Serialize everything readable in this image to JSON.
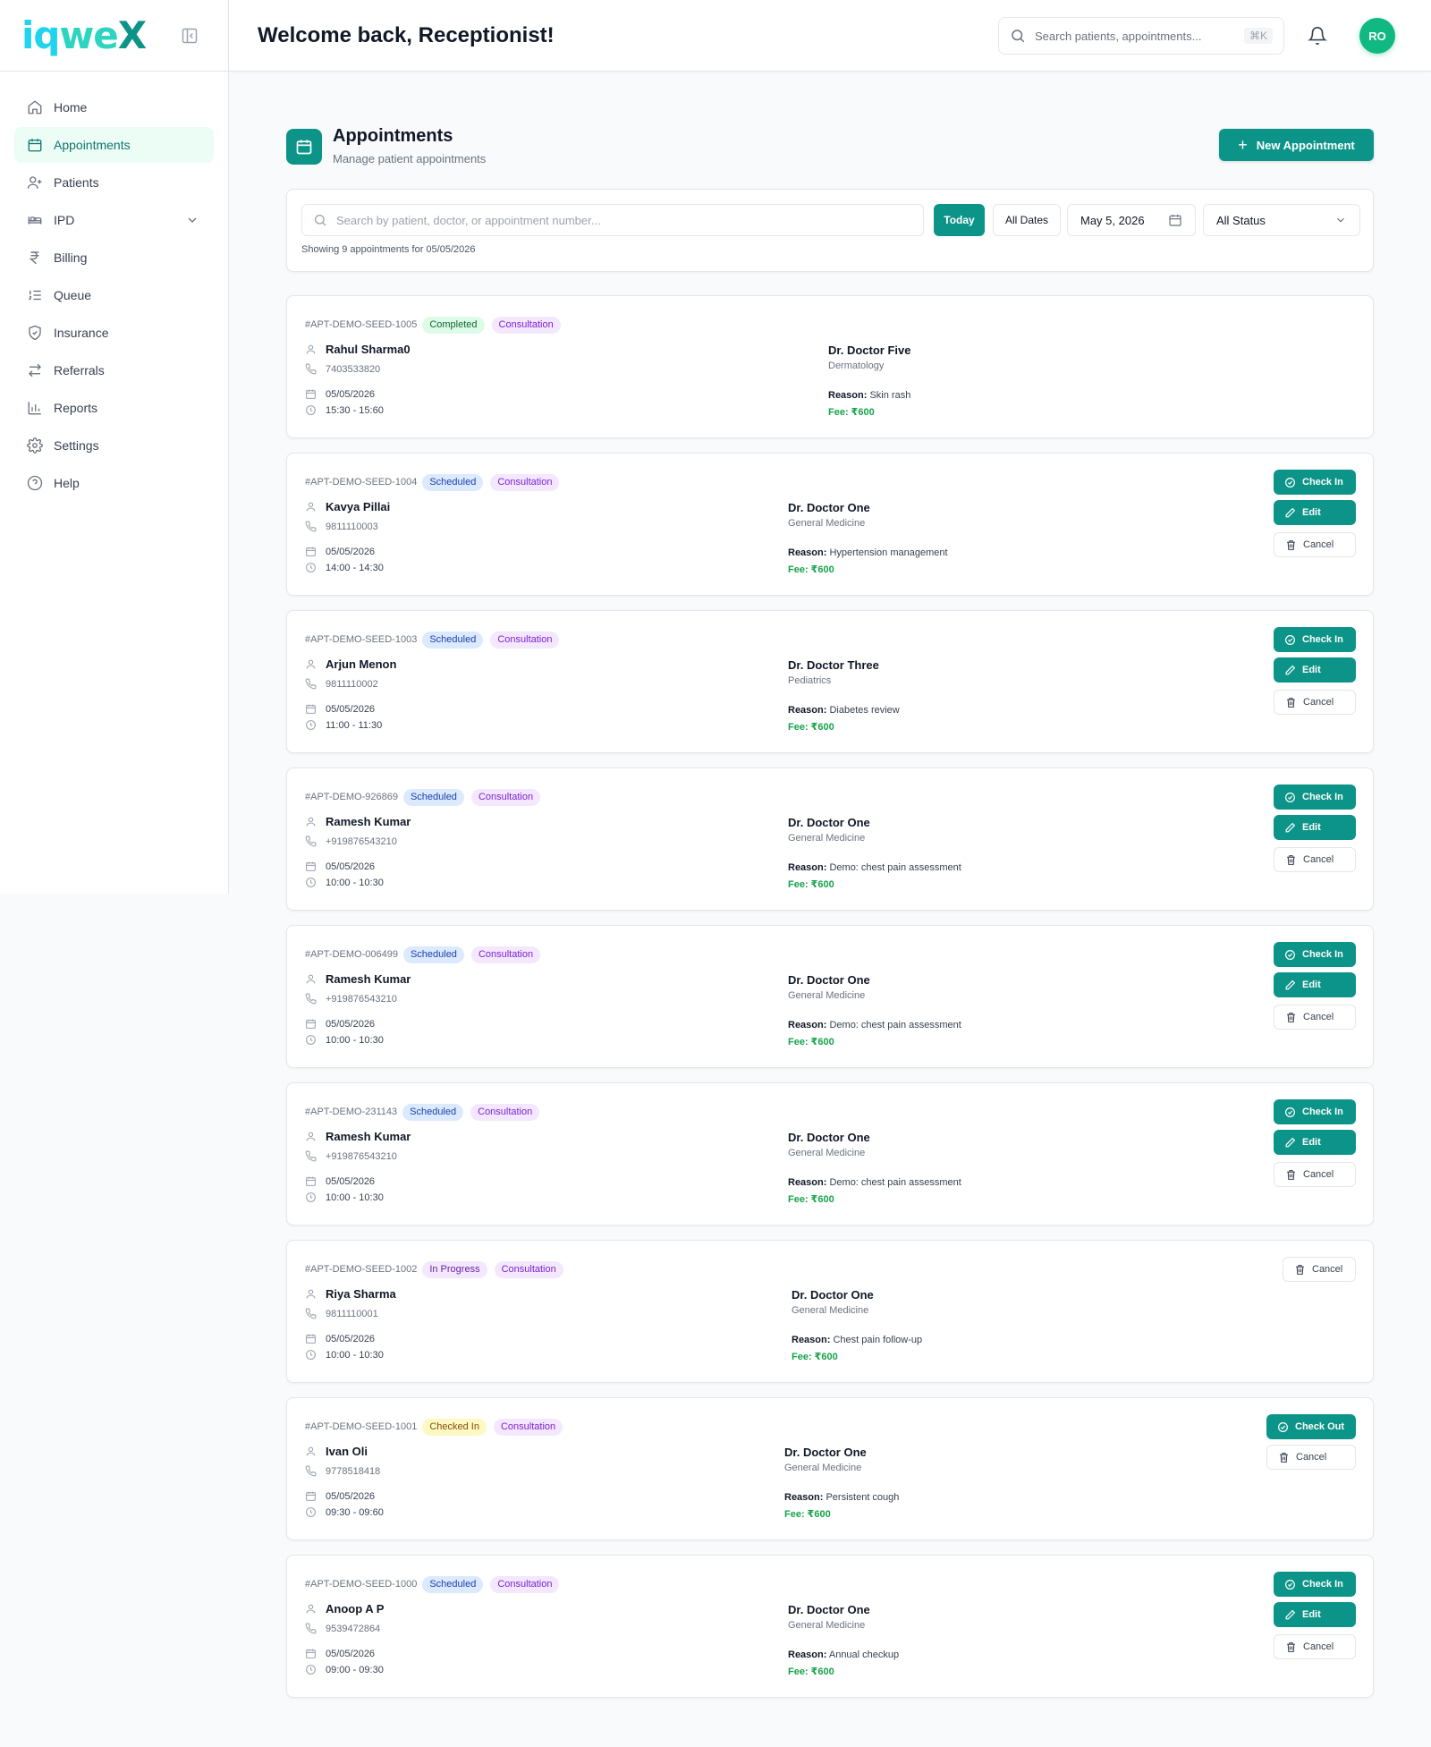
{
  "app": {
    "logo": {
      "l1": "iq",
      "l2": "we",
      "l3": "X"
    }
  },
  "nav": {
    "items": [
      {
        "label": "Home",
        "icon": "home-icon"
      },
      {
        "label": "Appointments",
        "icon": "calendar-icon"
      },
      {
        "label": "Patients",
        "icon": "user-plus-icon"
      },
      {
        "label": "IPD",
        "icon": "bed-icon"
      },
      {
        "label": "Billing",
        "icon": "rupee-icon"
      },
      {
        "label": "Queue",
        "icon": "list-ordered-icon"
      },
      {
        "label": "Insurance",
        "icon": "shield-check-icon"
      },
      {
        "label": "Referrals",
        "icon": "arrows-exchange-icon"
      },
      {
        "label": "Reports",
        "icon": "bar-chart-icon"
      },
      {
        "label": "Settings",
        "icon": "gear-icon"
      },
      {
        "label": "Help",
        "icon": "help-circle-icon"
      }
    ]
  },
  "header": {
    "welcome": "Welcome back, Receptionist!",
    "search_placeholder": "Search patients, appointments...",
    "shortcut": "⌘K",
    "avatar": "RO"
  },
  "page": {
    "title": "Appointments",
    "subtitle": "Manage patient appointments",
    "new_button": "New Appointment"
  },
  "filters": {
    "search_placeholder": "Search by patient, doctor, or appointment number...",
    "today": "Today",
    "all_dates": "All Dates",
    "date": "May 5, 2026",
    "status": "All Status",
    "showing": "Showing 9 appointments for 05/05/2026"
  },
  "appointments": [
    {
      "id": "#APT-DEMO-SEED-1005",
      "status": "Completed",
      "type": "Consultation",
      "patient": "Rahul Sharma0",
      "phone": "7403533820",
      "date": "05/05/2026",
      "time": "15:30 - 15:60",
      "doctor": "Dr. Doctor Five",
      "dept": "Dermatology",
      "reason_label": "Reason:",
      "reason": "Skin rash",
      "fee": "Fee: ₹600",
      "actions": []
    },
    {
      "id": "#APT-DEMO-SEED-1004",
      "status": "Scheduled",
      "type": "Consultation",
      "patient": "Kavya Pillai",
      "phone": "9811110003",
      "date": "05/05/2026",
      "time": "14:00 - 14:30",
      "doctor": "Dr. Doctor One",
      "dept": "General Medicine",
      "reason_label": "Reason:",
      "reason": "Hypertension management",
      "fee": "Fee: ₹600",
      "actions": [
        "Check In",
        "Edit",
        "Cancel"
      ]
    },
    {
      "id": "#APT-DEMO-SEED-1003",
      "status": "Scheduled",
      "type": "Consultation",
      "patient": "Arjun Menon",
      "phone": "9811110002",
      "date": "05/05/2026",
      "time": "11:00 - 11:30",
      "doctor": "Dr. Doctor Three",
      "dept": "Pediatrics",
      "reason_label": "Reason:",
      "reason": "Diabetes review",
      "fee": "Fee: ₹600",
      "actions": [
        "Check In",
        "Edit",
        "Cancel"
      ]
    },
    {
      "id": "#APT-DEMO-926869",
      "status": "Scheduled",
      "type": "Consultation",
      "patient": "Ramesh Kumar",
      "phone": "+919876543210",
      "date": "05/05/2026",
      "time": "10:00 - 10:30",
      "doctor": "Dr. Doctor One",
      "dept": "General Medicine",
      "reason_label": "Reason:",
      "reason": "Demo: chest pain assessment",
      "fee": "Fee: ₹600",
      "actions": [
        "Check In",
        "Edit",
        "Cancel"
      ]
    },
    {
      "id": "#APT-DEMO-006499",
      "status": "Scheduled",
      "type": "Consultation",
      "patient": "Ramesh Kumar",
      "phone": "+919876543210",
      "date": "05/05/2026",
      "time": "10:00 - 10:30",
      "doctor": "Dr. Doctor One",
      "dept": "General Medicine",
      "reason_label": "Reason:",
      "reason": "Demo: chest pain assessment",
      "fee": "Fee: ₹600",
      "actions": [
        "Check In",
        "Edit",
        "Cancel"
      ]
    },
    {
      "id": "#APT-DEMO-231143",
      "status": "Scheduled",
      "type": "Consultation",
      "patient": "Ramesh Kumar",
      "phone": "+919876543210",
      "date": "05/05/2026",
      "time": "10:00 - 10:30",
      "doctor": "Dr. Doctor One",
      "dept": "General Medicine",
      "reason_label": "Reason:",
      "reason": "Demo: chest pain assessment",
      "fee": "Fee: ₹600",
      "actions": [
        "Check In",
        "Edit",
        "Cancel"
      ]
    },
    {
      "id": "#APT-DEMO-SEED-1002",
      "status": "In Progress",
      "type": "Consultation",
      "patient": "Riya Sharma",
      "phone": "9811110001",
      "date": "05/05/2026",
      "time": "10:00 - 10:30",
      "doctor": "Dr. Doctor One",
      "dept": "General Medicine",
      "reason_label": "Reason:",
      "reason": "Chest pain follow-up",
      "fee": "Fee: ₹600",
      "actions": [
        "Cancel"
      ]
    },
    {
      "id": "#APT-DEMO-SEED-1001",
      "status": "Checked In",
      "type": "Consultation",
      "patient": "Ivan Oli",
      "phone": "9778518418",
      "date": "05/05/2026",
      "time": "09:30 - 09:60",
      "doctor": "Dr. Doctor One",
      "dept": "General Medicine",
      "reason_label": "Reason:",
      "reason": "Persistent cough",
      "fee": "Fee: ₹600",
      "actions": [
        "Check Out",
        "Cancel"
      ]
    },
    {
      "id": "#APT-DEMO-SEED-1000",
      "status": "Scheduled",
      "type": "Consultation",
      "patient": "Anoop A P",
      "phone": "9539472864",
      "date": "05/05/2026",
      "time": "09:00 - 09:30",
      "doctor": "Dr. Doctor One",
      "dept": "General Medicine",
      "reason_label": "Reason:",
      "reason": "Annual checkup",
      "fee": "Fee: ₹600",
      "actions": [
        "Check In",
        "Edit",
        "Cancel"
      ]
    }
  ]
}
